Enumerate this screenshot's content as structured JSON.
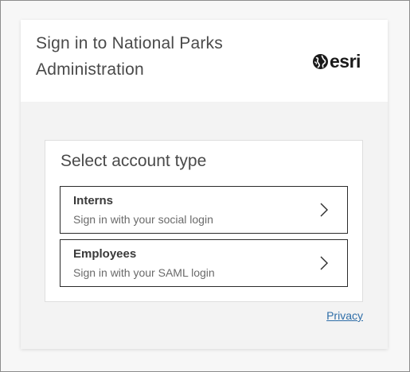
{
  "header": {
    "title": "Sign in to National Parks Administration",
    "logo": {
      "icon": "globe-icon",
      "text": "esri"
    }
  },
  "account_panel": {
    "title": "Select account type",
    "options": [
      {
        "title": "Interns",
        "subtitle": "Sign in with your social login",
        "icon": "chevron-right-icon"
      },
      {
        "title": "Employees",
        "subtitle": "Sign in with your SAML login",
        "icon": "chevron-right-icon"
      }
    ]
  },
  "footer": {
    "privacy_label": "Privacy"
  },
  "colors": {
    "link": "#2f6ea8",
    "border": "#2b2b2b",
    "card_bg": "#f3f3f3",
    "header_bg": "#ffffff"
  }
}
